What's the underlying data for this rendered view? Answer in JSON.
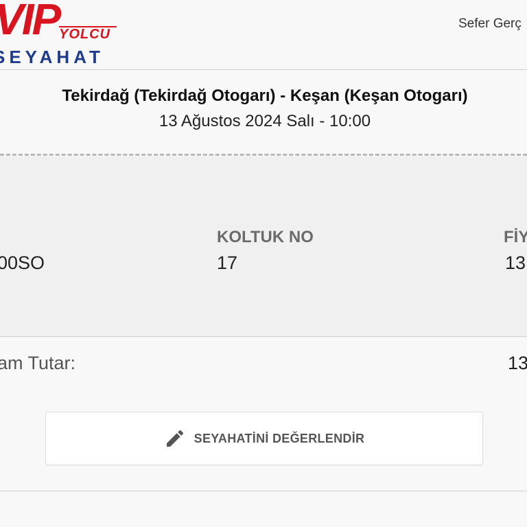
{
  "header": {
    "logo": {
      "brand_top": "VIP",
      "brand_sub": "YOLCU",
      "brand_bottom": "SEYAHAT"
    },
    "right_text": "Sefer Gerç"
  },
  "trip": {
    "route": "Tekirdağ (Tekirdağ Otogarı) - Keşan (Keşan Otogarı)",
    "datetime": "13 Ağustos 2024 Salı - 10:00"
  },
  "ticket": {
    "columns": [
      {
        "label": "",
        "value": "00SO"
      },
      {
        "label": "KOLTUK NO",
        "value": "17"
      },
      {
        "label": "FİY",
        "value": "13"
      }
    ]
  },
  "total": {
    "label": "am Tutar:",
    "value": "13"
  },
  "actions": {
    "rate_label": "SEYAHATİNİ DEĞERLENDİR",
    "rate_icon": "pencil-icon"
  },
  "colors": {
    "brand_red": "#d7141f",
    "brand_blue": "#1f3b8a"
  }
}
